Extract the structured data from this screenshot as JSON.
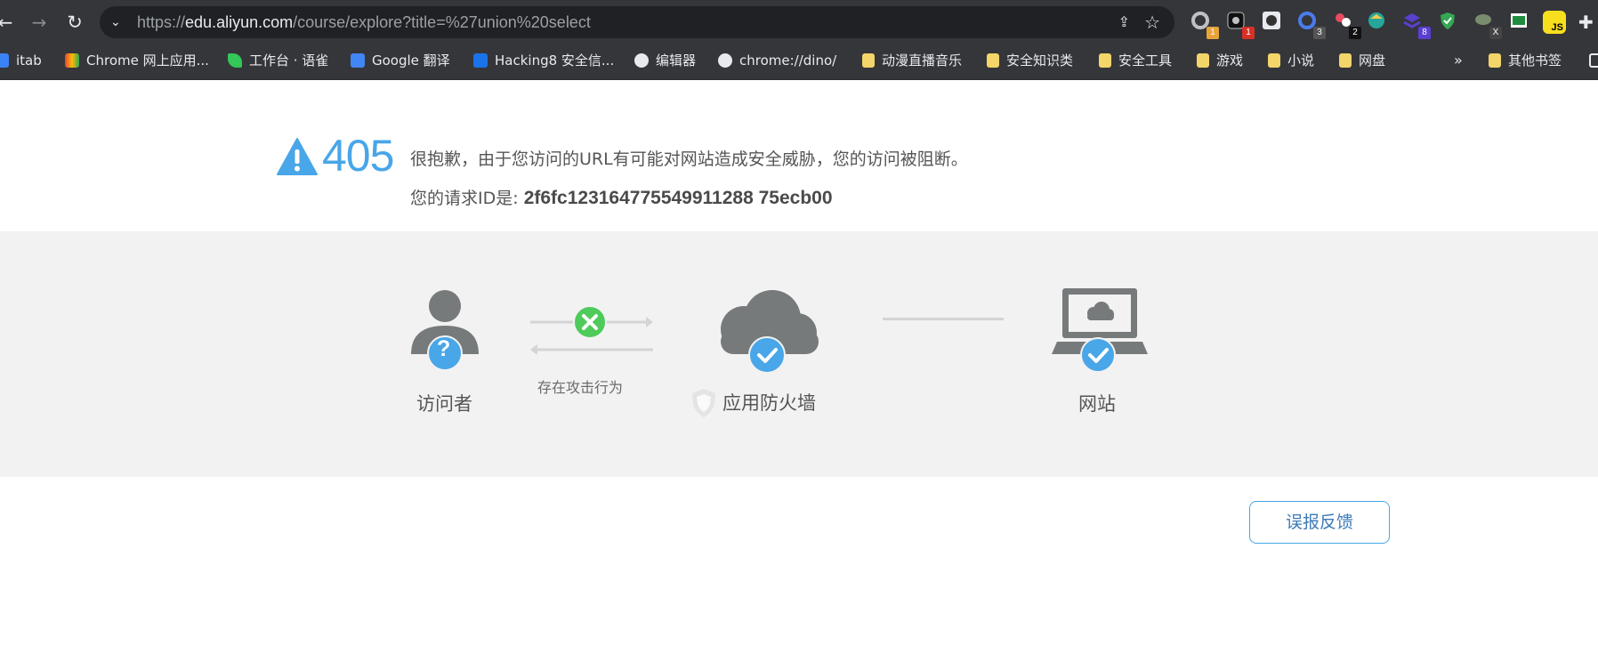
{
  "browser": {
    "url_scheme": "https://",
    "url_host": "edu.aliyun.com",
    "url_path": "/course/explore?title=%27union%20select",
    "extension_badges": [
      "1",
      "1",
      "3",
      "2",
      "8",
      "X",
      "JS"
    ]
  },
  "bookmarks": {
    "items": [
      {
        "label": "itab",
        "icon": "itab-icon"
      },
      {
        "label": "Chrome 网上应用...",
        "icon": "chrome-webstore-icon"
      },
      {
        "label": "工作台 · 语雀",
        "icon": "yuque-icon"
      },
      {
        "label": "Google 翻译",
        "icon": "google-translate-icon"
      },
      {
        "label": "Hacking8 安全信...",
        "icon": "hacking8-icon"
      },
      {
        "label": "编辑器",
        "icon": "globe-icon"
      },
      {
        "label": "chrome://dino/",
        "icon": "globe-icon"
      },
      {
        "label": "动漫直播音乐",
        "icon": "folder-icon"
      },
      {
        "label": "安全知识类",
        "icon": "folder-icon"
      },
      {
        "label": "安全工具",
        "icon": "folder-icon"
      },
      {
        "label": "游戏",
        "icon": "folder-icon"
      },
      {
        "label": "小说",
        "icon": "folder-icon"
      },
      {
        "label": "网盘",
        "icon": "folder-icon"
      }
    ],
    "more": "»",
    "other": "其他书签"
  },
  "error": {
    "code": "405",
    "message": "很抱歉，由于您访问的URL有可能对网站造成安全威胁，您的访问被阻断。",
    "request_id_label": "您的请求ID是: ",
    "request_id": "2f6fc123164775549911288 75ecb00"
  },
  "diagram": {
    "visitor": "访问者",
    "attack": "存在攻击行为",
    "waf": "应用防火墙",
    "site": "网站"
  },
  "feedback": {
    "label": "误报反馈"
  },
  "colors": {
    "accent": "#49a6e8",
    "block": "#4fcb5b",
    "gray_icon": "#777a7b"
  }
}
